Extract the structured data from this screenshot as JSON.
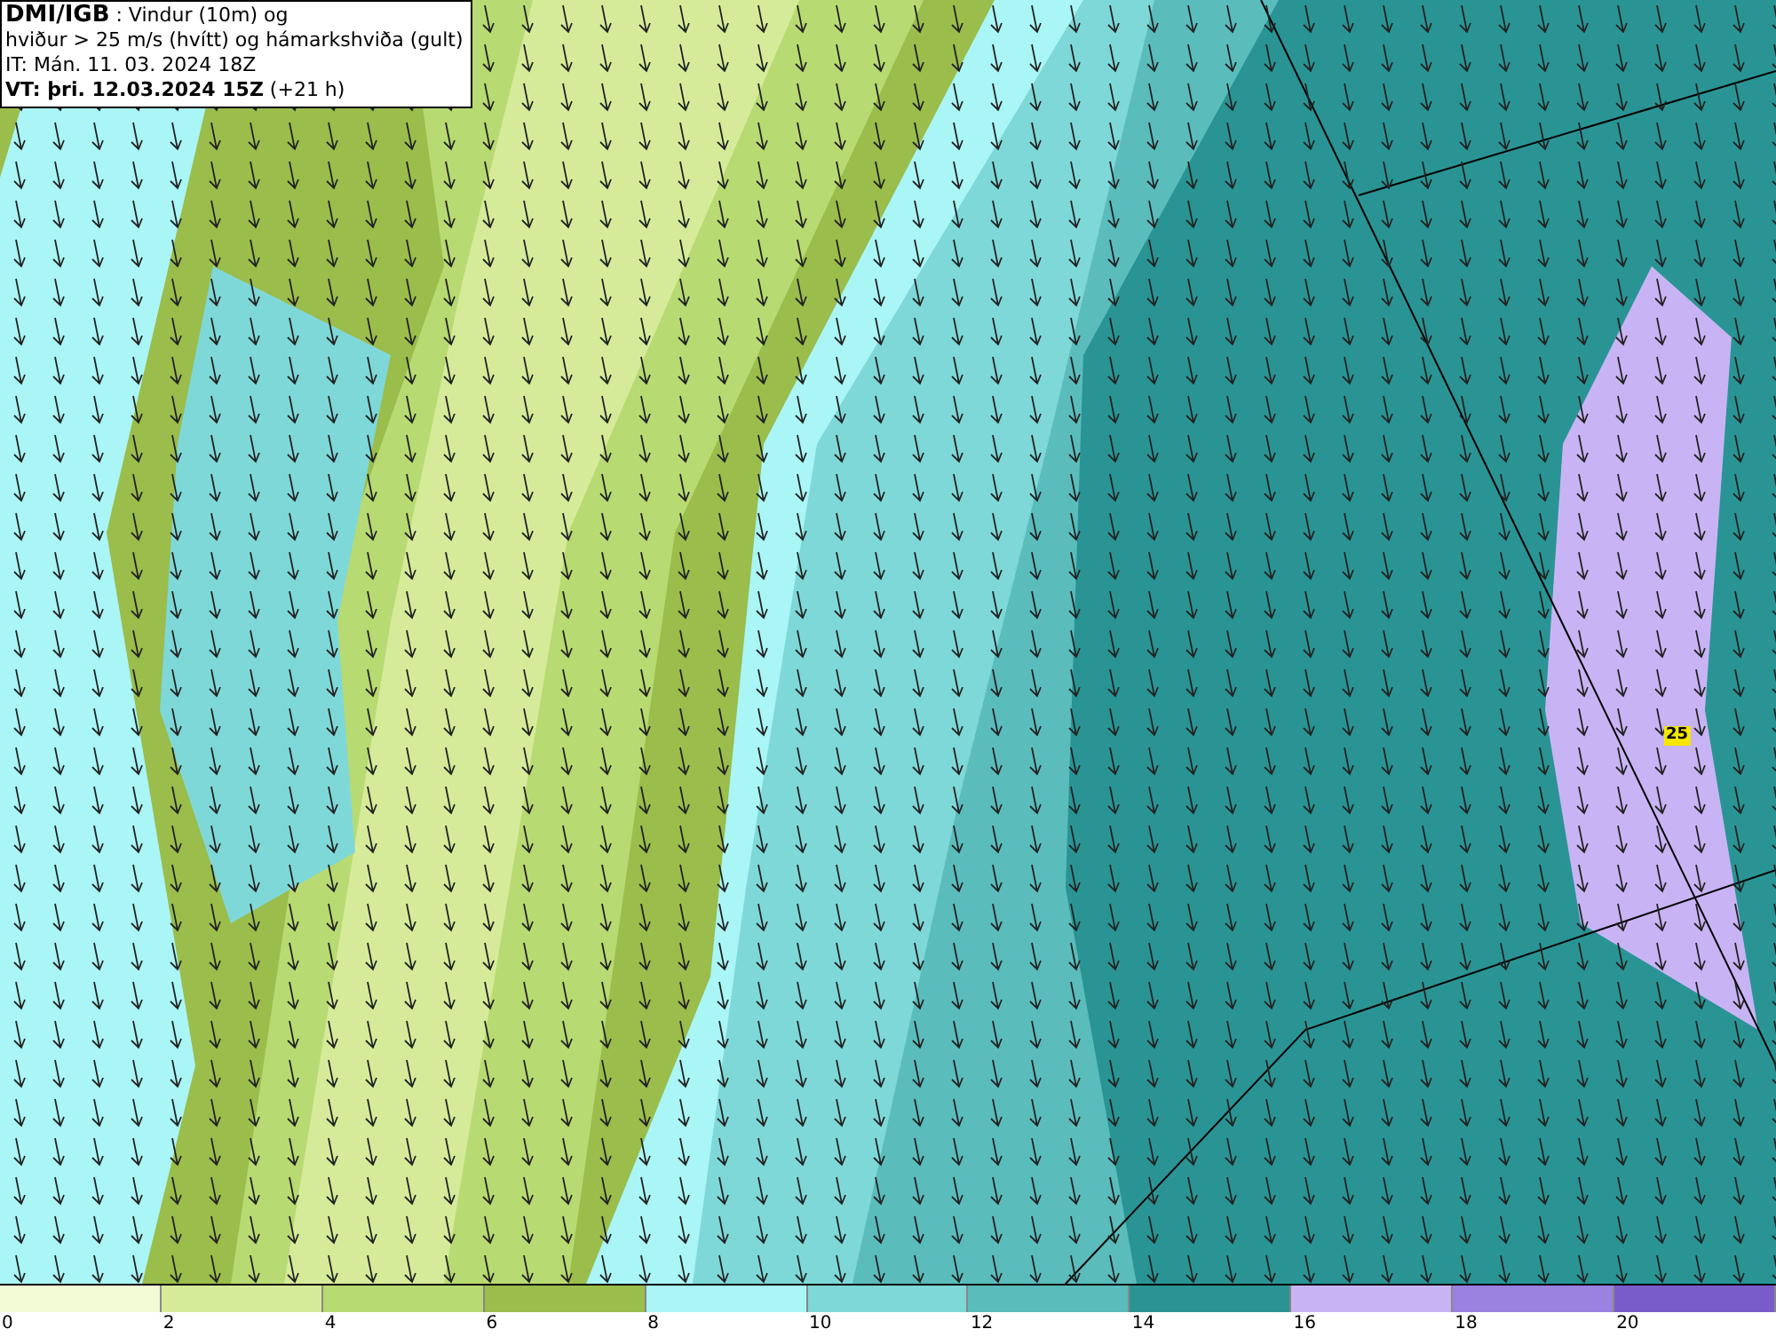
{
  "header": {
    "lines": [
      "**DMI/IGB** : Vindur (10m) og",
      "hviður > 25 m/s (hvítt) og hámarkshviða (gult)",
      "IT: Mán. 11. 03. 2024 18Z",
      "**VT: þri. 12.03.2024 15Z** (+21 h)"
    ]
  },
  "map": {
    "gust_marker": "25"
  },
  "legend": {
    "bins": [
      {
        "color": "#f2fad6"
      },
      {
        "color": "#d6eb9a"
      },
      {
        "color": "#b8da72"
      },
      {
        "color": "#9abd4c"
      },
      {
        "color": "#aaf5f5"
      },
      {
        "color": "#7fd8d8"
      },
      {
        "color": "#5bbcbc"
      },
      {
        "color": "#2a9494"
      },
      {
        "color": "#c8b4f5"
      },
      {
        "color": "#9b82e0"
      },
      {
        "color": "#7a5cc8"
      }
    ],
    "labels": [
      "0",
      "2",
      "4",
      "6",
      "8",
      "10",
      "12",
      "14",
      "16",
      "18",
      "20"
    ]
  }
}
